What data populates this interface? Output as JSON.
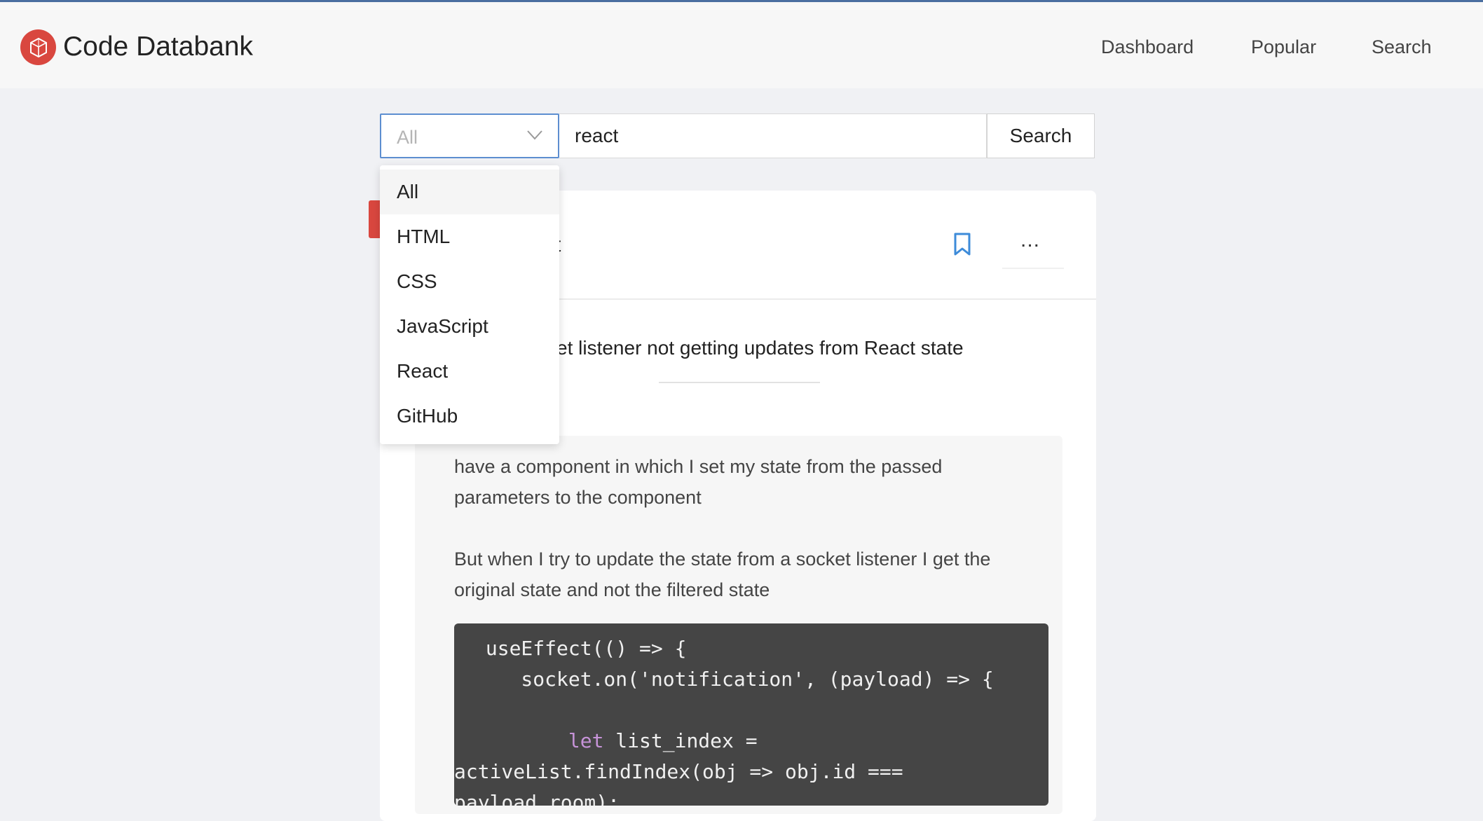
{
  "app": {
    "brand": "Code Databank"
  },
  "nav": {
    "links": [
      "Dashboard",
      "Popular",
      "Search"
    ]
  },
  "search": {
    "category_value": "All",
    "query": "react",
    "button_label": "Search"
  },
  "dropdown": {
    "options": [
      "All",
      "HTML",
      "CSS",
      "JavaScript",
      "React",
      "GitHub"
    ],
    "highlighted": "All"
  },
  "post": {
    "header_fragment": "t",
    "more_label": "...",
    "title_fragment": "et listener not getting updates from React state",
    "paragraphs": [
      "have a component in which I set my state from the passed parameters to the component",
      "But when I try to update the state from a socket listener I get the original state and not the filtered state"
    ],
    "code_lines": [
      " useEffect(() => {",
      "    socket.on('notification', (payload) => {",
      "",
      "        let list_index =",
      "activeList.findIndex(obj => obj.id ===",
      "payload.room);"
    ]
  },
  "colors": {
    "accent": "#d9473f",
    "link_blue": "#3d8bd9",
    "code_bg": "#454545"
  }
}
